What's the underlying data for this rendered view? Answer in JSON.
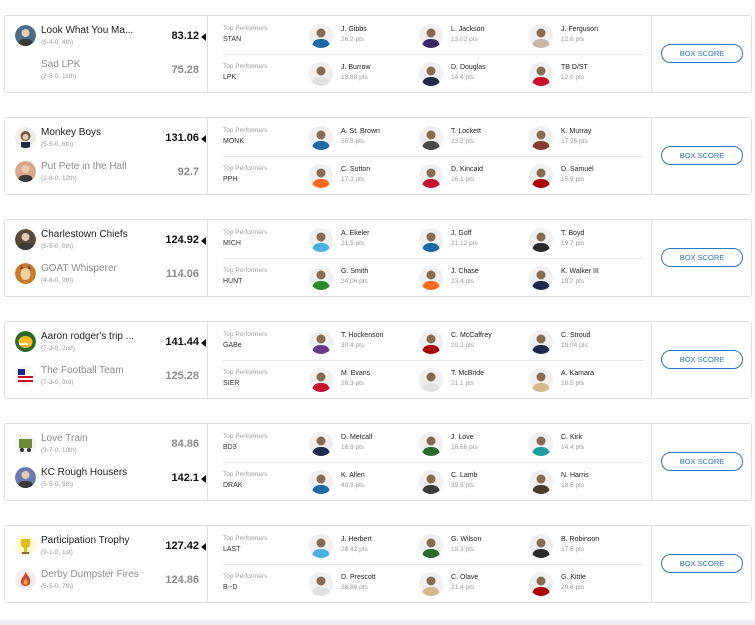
{
  "matchups": [
    {
      "teams": [
        {
          "name": "Look What You Ma...",
          "record": "(6-4-0, 4th)",
          "score": "83.12",
          "winner": true,
          "logo_color": "#4a6b8a",
          "logo_icon": "person-avatar"
        },
        {
          "name": "Sad LPK",
          "record": "(2-8-0, 11th)",
          "score": "75.28",
          "winner": false,
          "logo_color": "#ffffff",
          "logo_icon": "none"
        }
      ],
      "performers": [
        {
          "label": "Top Performers",
          "abbr": "STAN",
          "players": [
            {
              "name": "J. Gibbs",
              "pts": "26.2 pts",
              "jersey": "#1b6aa5"
            },
            {
              "name": "L. Jackson",
              "pts": "13.02 pts",
              "jersey": "#3a2a6b"
            },
            {
              "name": "J. Ferguson",
              "pts": "12.6 pts",
              "jersey": "#c9b8a8"
            }
          ]
        },
        {
          "label": "Top Performers",
          "abbr": "LPK",
          "players": [
            {
              "name": "J. Burrow",
              "pts": "19.88 pts",
              "jersey": "#e0e0e0"
            },
            {
              "name": "D. Douglas",
              "pts": "14.4 pts",
              "jersey": "#1e2a4a"
            },
            {
              "name": "TB D/ST",
              "pts": "12.0 pts",
              "jersey": "#c8102e"
            }
          ]
        }
      ]
    },
    {
      "teams": [
        {
          "name": "Monkey Boys",
          "record": "(5-5-0, 6th)",
          "score": "131.06",
          "winner": true,
          "logo_color": "#6b5a40",
          "logo_icon": "monkey-avatar"
        },
        {
          "name": "Put Pete in the Hall",
          "record": "(2-8-0, 12th)",
          "score": "92.7",
          "winner": false,
          "logo_color": "#d9a88a",
          "logo_icon": "person-avatar"
        }
      ],
      "performers": [
        {
          "label": "Top Performers",
          "abbr": "MONK",
          "players": [
            {
              "name": "A. St. Brown",
              "pts": "30.5 pts",
              "jersey": "#1b6aa5"
            },
            {
              "name": "T. Lockett",
              "pts": "23.2 pts",
              "jersey": "#4a4a4a"
            },
            {
              "name": "K. Murray",
              "pts": "17.26 pts",
              "jersey": "#8a3a2a"
            }
          ]
        },
        {
          "label": "Top Performers",
          "abbr": "PPH",
          "players": [
            {
              "name": "C. Sutton",
              "pts": "17.3 pts",
              "jersey": "#ff6b1a"
            },
            {
              "name": "D. Kincaid",
              "pts": "16.1 pts",
              "jersey": "#c8102e"
            },
            {
              "name": "D. Samuel",
              "pts": "15.9 pts",
              "jersey": "#aa0000"
            }
          ]
        }
      ]
    },
    {
      "teams": [
        {
          "name": "Charlestown Chiefs",
          "record": "(5-5-0, 8th)",
          "score": "124.92",
          "winner": true,
          "logo_color": "#5a4a3a",
          "logo_icon": "person-avatar"
        },
        {
          "name": "GOAT Whisperer",
          "record": "(4-6-0, 9th)",
          "score": "114.06",
          "winner": false,
          "logo_color": "#c87a2a",
          "logo_icon": "goat-avatar"
        }
      ],
      "performers": [
        {
          "label": "Top Performers",
          "abbr": "MICH",
          "players": [
            {
              "name": "A. Ekeler",
              "pts": "21.5 pts",
              "jersey": "#4ab0e0"
            },
            {
              "name": "J. Goff",
              "pts": "21.12 pts",
              "jersey": "#1b6aa5"
            },
            {
              "name": "T. Boyd",
              "pts": "19.7 pts",
              "jersey": "#2a2a2a"
            }
          ]
        },
        {
          "label": "Top Performers",
          "abbr": "HUNT",
          "players": [
            {
              "name": "G. Smith",
              "pts": "24.06 pts",
              "jersey": "#2a8a2a"
            },
            {
              "name": "J. Chase",
              "pts": "23.4 pts",
              "jersey": "#ff6b1a"
            },
            {
              "name": "K. Walker III",
              "pts": "19.7 pts",
              "jersey": "#1e2a4a"
            }
          ]
        }
      ]
    },
    {
      "teams": [
        {
          "name": "Aaron rodger's trip ...",
          "record": "(7-3-0, 2nd)",
          "score": "141.44",
          "winner": true,
          "logo_color": "#2a6a2a",
          "logo_icon": "helmet-icon"
        },
        {
          "name": "The Football Team",
          "record": "(7-3-0, 3rd)",
          "score": "125.28",
          "winner": false,
          "logo_color": "#c8102e",
          "logo_icon": "flag-icon"
        }
      ],
      "performers": [
        {
          "label": "Top Performers",
          "abbr": "GABe",
          "players": [
            {
              "name": "T. Hockenson",
              "pts": "30.4 pts",
              "jersey": "#6a3a8a"
            },
            {
              "name": "C. McCaffrey",
              "pts": "20.2 pts",
              "jersey": "#aa0000"
            },
            {
              "name": "C. Stroud",
              "pts": "19.04 pts",
              "jersey": "#1e2a4a"
            }
          ]
        },
        {
          "label": "Top Performers",
          "abbr": "SIER",
          "players": [
            {
              "name": "M. Evans",
              "pts": "26.3 pts",
              "jersey": "#c8102e"
            },
            {
              "name": "T. McBride",
              "pts": "21.1 pts",
              "jersey": "#e0e0e0"
            },
            {
              "name": "A. Kamara",
              "pts": "18.5 pts",
              "jersey": "#d4b98a"
            }
          ]
        }
      ]
    },
    {
      "teams": [
        {
          "name": "Love Train",
          "record": "(3-7-0, 10th)",
          "score": "84.86",
          "winner": false,
          "logo_color": "#6b8a3a",
          "logo_icon": "train-icon"
        },
        {
          "name": "KC Rough Housers",
          "record": "(5-5-0, 5th)",
          "score": "142.1",
          "winner": true,
          "logo_color": "#6a7ab0",
          "logo_icon": "person-avatar"
        }
      ],
      "performers": [
        {
          "label": "Top Performers",
          "abbr": "BD3",
          "players": [
            {
              "name": "D. Metcalf",
              "pts": "16.8 pts",
              "jersey": "#1e2a4a"
            },
            {
              "name": "J. Love",
              "pts": "16.66 pts",
              "jersey": "#2a6a2a"
            },
            {
              "name": "C. Kirk",
              "pts": "14.4 pts",
              "jersey": "#1aa0a0"
            }
          ]
        },
        {
          "label": "Top Performers",
          "abbr": "DRAK",
          "players": [
            {
              "name": "K. Allen",
              "pts": "40.5 pts",
              "jersey": "#1b6aa5"
            },
            {
              "name": "C. Lamb",
              "pts": "39.5 pts",
              "jersey": "#3a3a3a"
            },
            {
              "name": "N. Harris",
              "pts": "18.6 pts",
              "jersey": "#4a3a2a"
            }
          ]
        }
      ]
    },
    {
      "teams": [
        {
          "name": "Participation Trophy",
          "record": "(9-1-0, 1st)",
          "score": "127.42",
          "winner": true,
          "logo_color": "#e0c020",
          "logo_icon": "trophy-icon"
        },
        {
          "name": "Derby Dumpster Fires",
          "record": "(5-5-0, 7th)",
          "score": "124.86",
          "winner": false,
          "logo_color": "#c84a3a",
          "logo_icon": "fire-icon"
        }
      ],
      "performers": [
        {
          "label": "Top Performers",
          "abbr": "LAST",
          "players": [
            {
              "name": "J. Herbert",
              "pts": "28.42 pts",
              "jersey": "#4ab0e0"
            },
            {
              "name": "G. Wilson",
              "pts": "18.3 pts",
              "jersey": "#2a6a2a"
            },
            {
              "name": "B. Robinson",
              "pts": "17.6 pts",
              "jersey": "#2a2a2a"
            }
          ]
        },
        {
          "label": "Top Performers",
          "abbr": "B--D",
          "players": [
            {
              "name": "D. Prescott",
              "pts": "38.86 pts",
              "jersey": "#e0e0e0"
            },
            {
              "name": "C. Olave",
              "pts": "21.4 pts",
              "jersey": "#d4b98a"
            },
            {
              "name": "G. Kittle",
              "pts": "20.6 pts",
              "jersey": "#aa0000"
            }
          ]
        }
      ]
    }
  ],
  "box_score_label": "BOX SCORE",
  "colors": {
    "accent": "#2a77c9",
    "border": "#dcdfe3"
  }
}
